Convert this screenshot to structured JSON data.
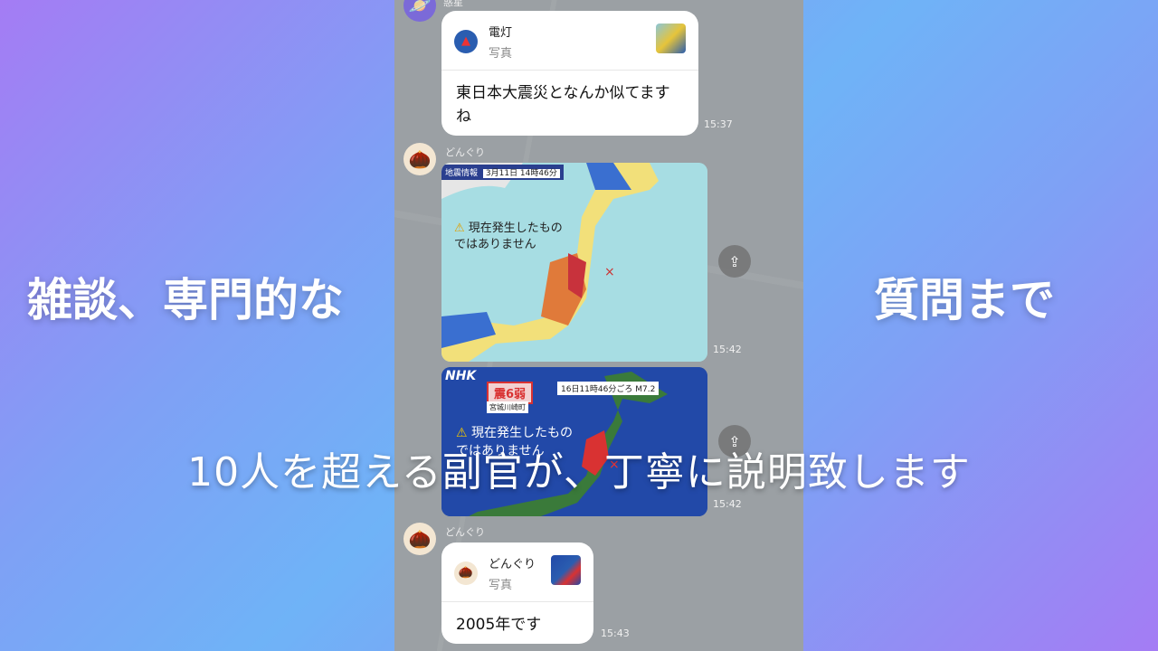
{
  "captions": {
    "left": "雑談、専門的な",
    "right": "質問まで",
    "subtitle": "10人を超える副官が、丁寧に説明致します"
  },
  "chat": {
    "message1": {
      "sender_name": "惑星",
      "avatar_icon": "planet-icon",
      "reply_to_name": "電灯",
      "reply_to_type": "写真",
      "text": "東日本大震災となんか似てますね",
      "time": "15:37"
    },
    "message2": {
      "sender_name": "どんぐり",
      "avatar_icon": "acorn-icon",
      "image1": {
        "header": "地震情報",
        "date": "3月11日 14時46分",
        "notice": "現在発生したものではありません",
        "time": "15:42"
      },
      "image2": {
        "broadcaster": "NHK",
        "intensity_label": "震6弱",
        "location": "宮城川崎町",
        "event_info": "16日11時46分ごろ M7.2",
        "notice": "現在発生したものではありません",
        "time": "15:42"
      }
    },
    "message3": {
      "sender_name": "どんぐり",
      "avatar_icon": "acorn-icon",
      "reply_to_name": "どんぐり",
      "reply_to_type": "写真",
      "text": "2005年です",
      "time": "15:43"
    }
  },
  "colors": {
    "bg_gradient_edge": "#a47cf4",
    "bg_gradient_center": "#6fb3f7",
    "map_sea": "#a7dde3",
    "nhk_blue": "#2249a8",
    "intensity_red": "#d93232"
  }
}
